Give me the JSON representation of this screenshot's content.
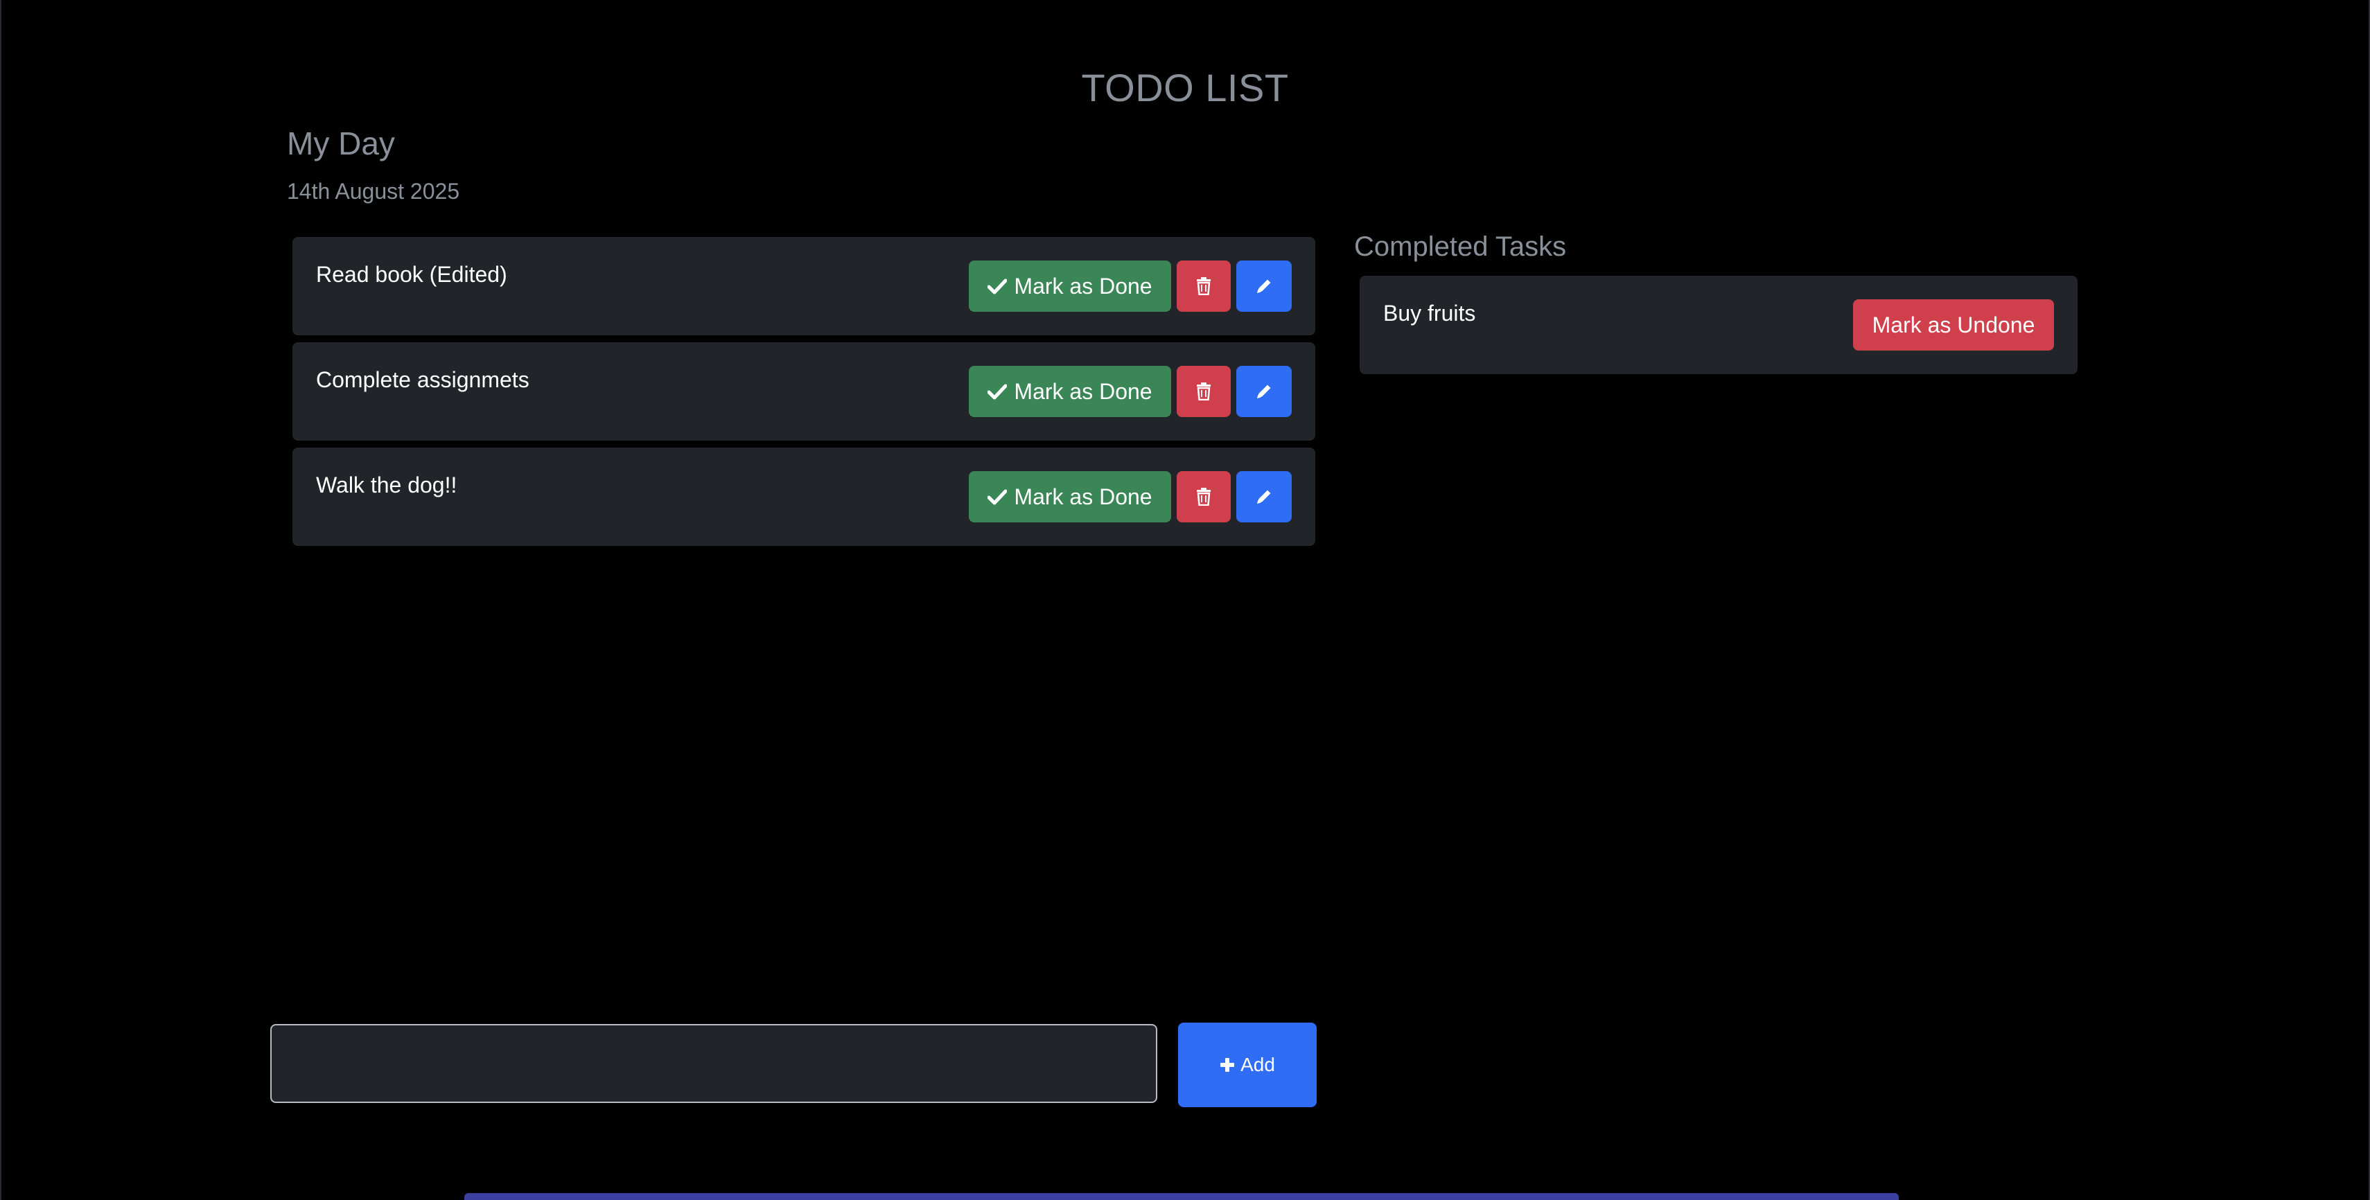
{
  "app": {
    "title": "TODO LIST"
  },
  "section": {
    "title": "My Day",
    "date": "14th August 2025"
  },
  "tasks": [
    {
      "text": "Read book (Edited)",
      "done_label": "Mark as Done",
      "done_icon": "check-icon",
      "delete_icon": "trash-icon",
      "edit_icon": "pencil-icon"
    },
    {
      "text": "Complete assignmets",
      "done_label": "Mark as Done",
      "done_icon": "check-icon",
      "delete_icon": "trash-icon",
      "edit_icon": "pencil-icon"
    },
    {
      "text": "Walk the dog!!",
      "done_label": "Mark as Done",
      "done_icon": "check-icon",
      "delete_icon": "trash-icon",
      "edit_icon": "pencil-icon"
    }
  ],
  "completed": {
    "title": "Completed Tasks",
    "items": [
      {
        "text": "Buy fruits",
        "undone_label": "Mark as Undone"
      }
    ]
  },
  "add_form": {
    "input_value": "",
    "input_placeholder": "",
    "button_label": "Add",
    "button_icon": "plus-icon"
  },
  "colors": {
    "background": "#000000",
    "card": "#212529",
    "muted_text": "#8a9099",
    "success": "#3b8657",
    "danger": "#d0404c",
    "primary": "#2f6df5"
  }
}
